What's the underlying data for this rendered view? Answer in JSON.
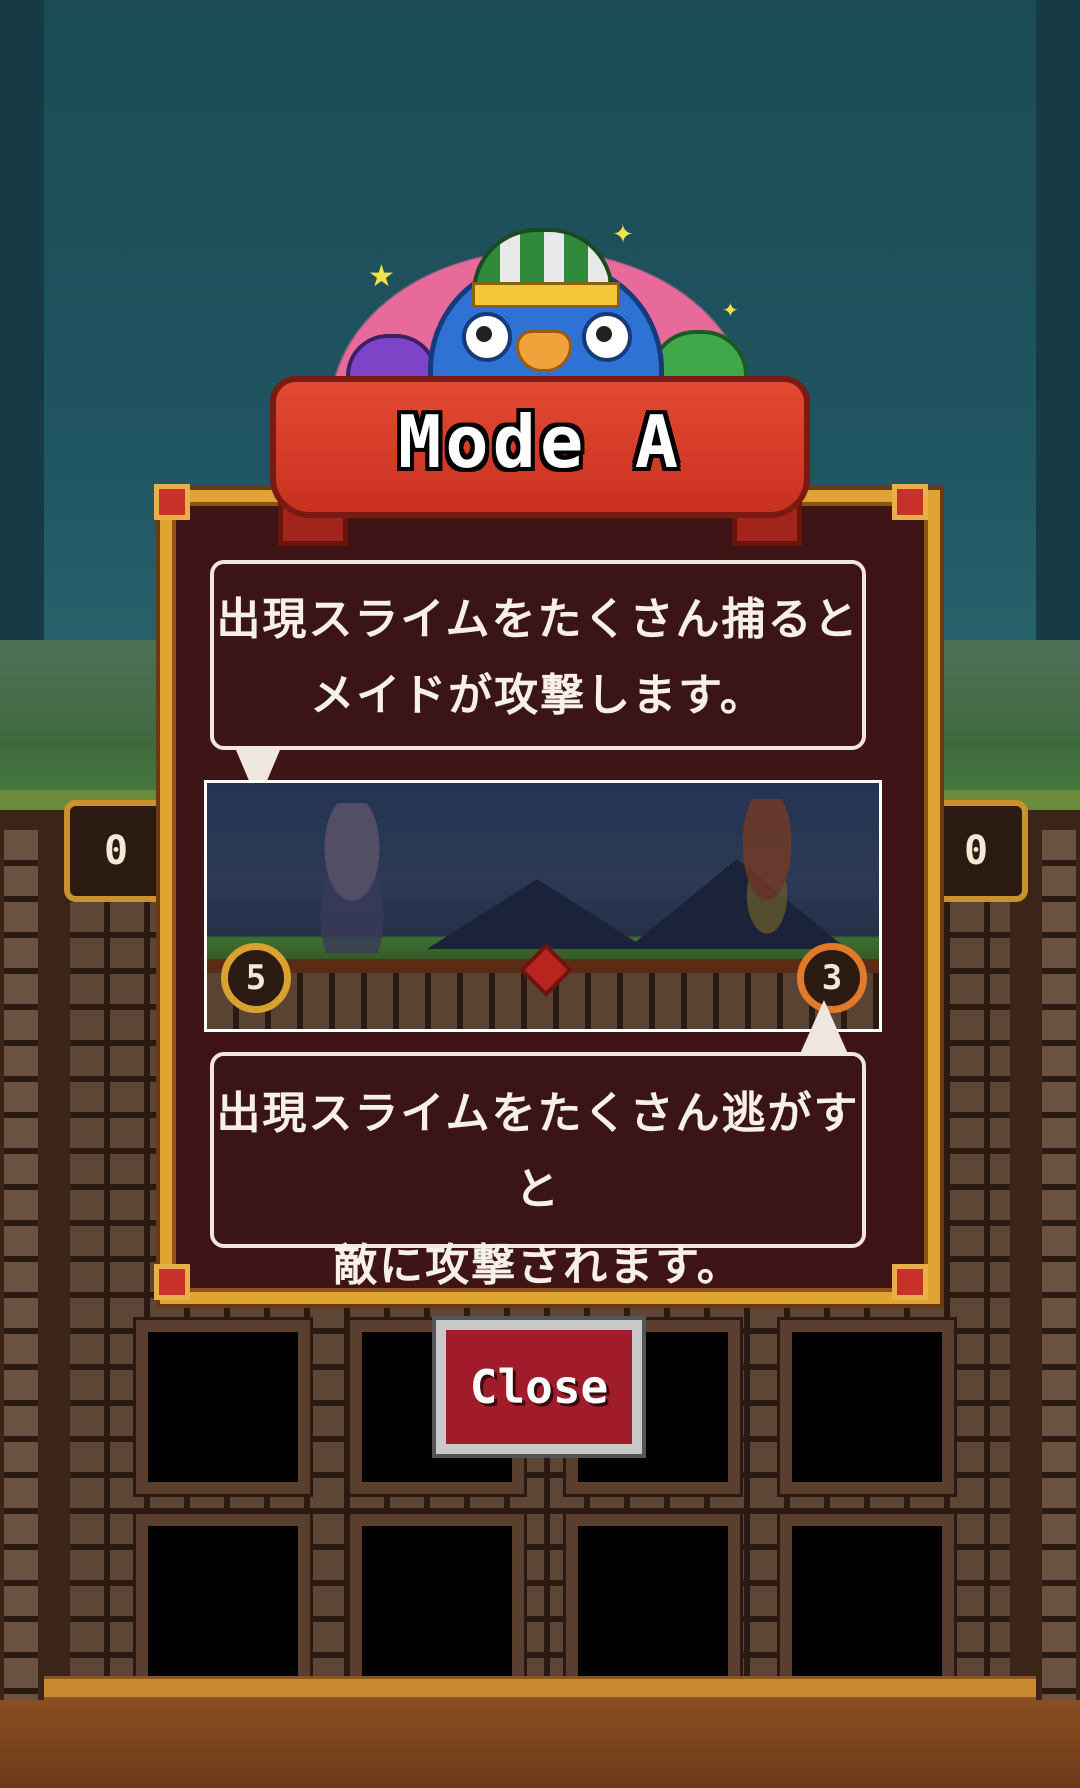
{
  "banner": {
    "title": "Mode A"
  },
  "instructions": {
    "top_line1": "出現スライムをたくさん捕ると",
    "top_line2": "メイドが攻撃します。",
    "bottom_line1": "出現スライムをたくさん逃がすと",
    "bottom_line2": "敵に攻撃されます。"
  },
  "preview": {
    "player_score": "5",
    "enemy_score": "3"
  },
  "board": {
    "left_counter": "0",
    "right_counter": "0"
  },
  "buttons": {
    "close_label": "Close"
  }
}
